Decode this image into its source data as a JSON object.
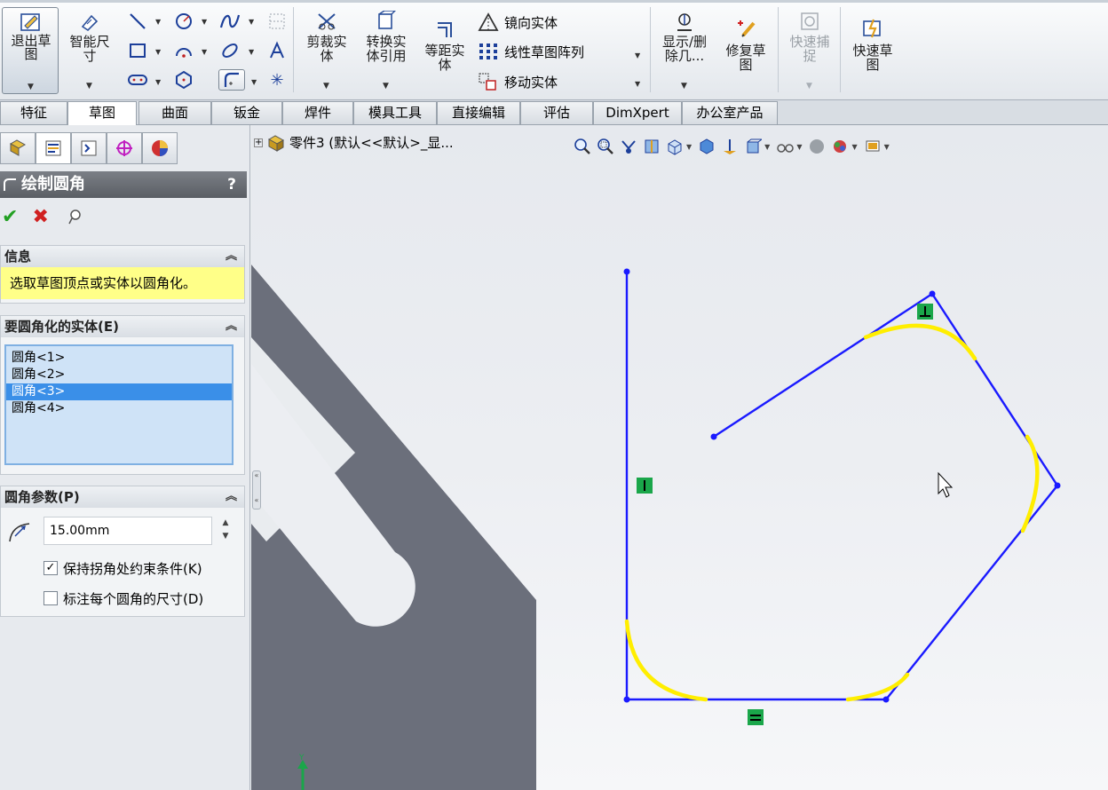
{
  "ribbon": {
    "exit_sketch": "退出草图",
    "smart_dim_line1": "智能尺",
    "smart_dim_line2": "寸",
    "trim_line1": "剪裁实",
    "trim_line2": "体",
    "convert_line1": "转换实",
    "convert_line2": "体引用",
    "offset_line1": "等距实",
    "offset_line2": "体",
    "mirror": "镜向实体",
    "linear_pattern": "线性草图阵列",
    "move": "移动实体",
    "display_delete_line1": "显示/删",
    "display_delete_line2": "除几...",
    "repair_line1": "修复草",
    "repair_line2": "图",
    "quick_snap_line1": "快速捕",
    "quick_snap_line2": "捉",
    "rapid_sketch_line1": "快速草",
    "rapid_sketch_line2": "图"
  },
  "tabs": [
    "特征",
    "草图",
    "曲面",
    "钣金",
    "焊件",
    "模具工具",
    "直接编辑",
    "评估",
    "DimXpert",
    "办公室产品"
  ],
  "active_tab": "草图",
  "property_manager": {
    "title": "绘制圆角",
    "help": "?",
    "info_group": {
      "title": "信息",
      "message": "选取草图顶点或实体以圆角化。"
    },
    "entities_group": {
      "title": "要圆角化的实体(E)",
      "items": [
        "圆角<1>",
        "圆角<2>",
        "圆角<3>",
        "圆角<4>"
      ],
      "selected_index": 2
    },
    "params_group": {
      "title": "圆角参数(P)",
      "radius_value": "15.00mm",
      "keep_constraints_label": "保持拐角处约束条件(K)",
      "keep_constraints_checked": true,
      "dimension_each_label": "标注每个圆角的尺寸(D)",
      "dimension_each_checked": false
    }
  },
  "tree": {
    "label": "零件3 (默认<<默认>_显..."
  },
  "colors": {
    "sketch_line": "#1a1aff",
    "fillet_highlight": "#ffee00",
    "relation_badge": "#1aa64a",
    "part_body": "#6b6f7b",
    "accent_selection": "#3a8fe8"
  }
}
